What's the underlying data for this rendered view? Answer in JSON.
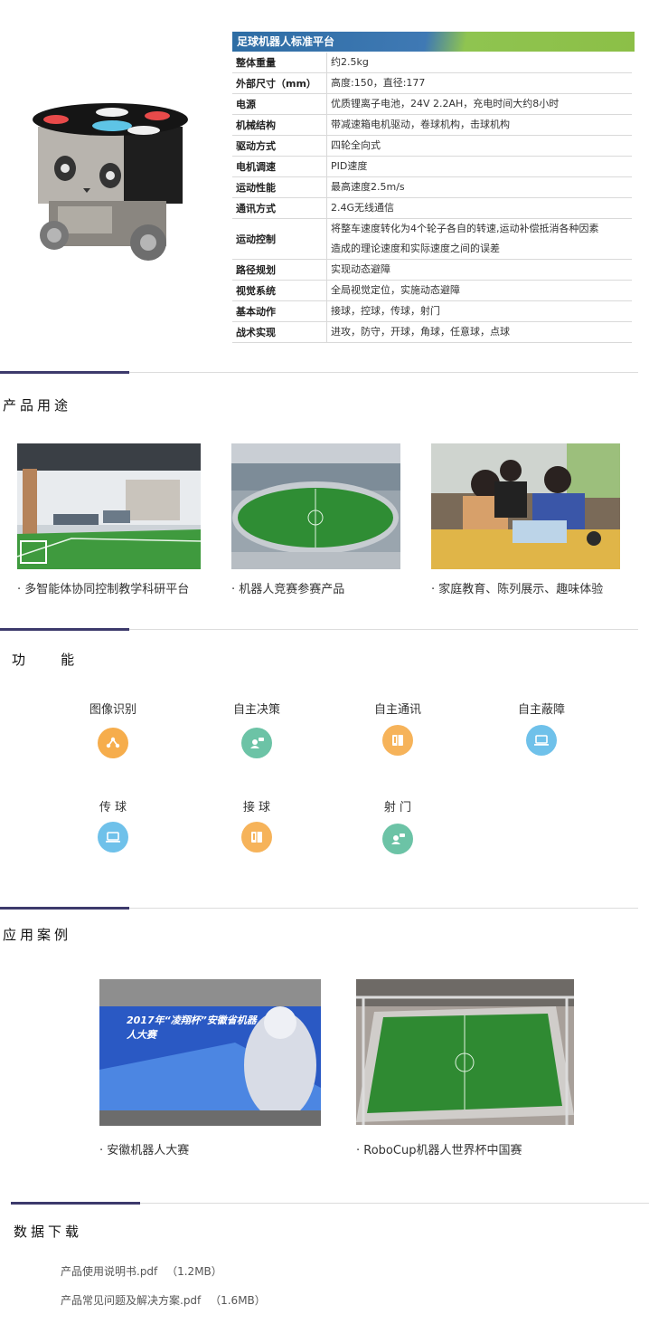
{
  "spec": {
    "title": "足球机器人标准平台",
    "rows": [
      {
        "k": "整体重量",
        "v": [
          "约2.5kg"
        ]
      },
      {
        "k": "外部尺寸（mm）",
        "v": [
          "高度:150，直径:177"
        ]
      },
      {
        "k": "电源",
        "v": [
          "优质锂离子电池，24V  2.2AH，充电时间大约8小时"
        ]
      },
      {
        "k": "机械结构",
        "v": [
          "带减速箱电机驱动，卷球机构，击球机构"
        ]
      },
      {
        "k": "驱动方式",
        "v": [
          "四轮全向式"
        ]
      },
      {
        "k": "电机调速",
        "v": [
          "PID速度"
        ]
      },
      {
        "k": "运动性能",
        "v": [
          "最高速度2.5m/s"
        ]
      },
      {
        "k": "通讯方式",
        "v": [
          "2.4G无线通信"
        ]
      },
      {
        "k": "运动控制",
        "v": [
          "将整车速度转化为4个轮子各自的转速,运动补偿抵消各种因素",
          "造成的理论速度和实际速度之间的误差"
        ]
      },
      {
        "k": "路径规划",
        "v": [
          "实现动态避障"
        ]
      },
      {
        "k": "视觉系统",
        "v": [
          "全局视觉定位，实施动态避障"
        ]
      },
      {
        "k": "基本动作",
        "v": [
          "接球，控球，传球，射门"
        ]
      },
      {
        "k": "战术实现",
        "v": [
          "进攻，防守，开球，角球，任意球，点球"
        ]
      }
    ]
  },
  "usage": {
    "title": "产品用途",
    "items": [
      {
        "caption": "· 多智能体协同控制教学科研平台"
      },
      {
        "caption": "· 机器人竞赛参赛产品"
      },
      {
        "caption": "· 家庭教育、陈列展示、趣味体验"
      }
    ]
  },
  "features": {
    "title": "功    能",
    "items": [
      {
        "label": "图像识别",
        "icon": "share-icon",
        "color": "#f6ad4c"
      },
      {
        "label": "自主决策",
        "icon": "user-chat-icon",
        "color": "#6cc3a6"
      },
      {
        "label": "自主通讯",
        "icon": "book-icon",
        "color": "#f6b35a"
      },
      {
        "label": "自主蔽障",
        "icon": "laptop-icon",
        "color": "#6fc1ea"
      },
      {
        "label": "传 球",
        "icon": "laptop-icon",
        "color": "#6fc1ea"
      },
      {
        "label": "接 球",
        "icon": "book-icon",
        "color": "#f6b35a"
      },
      {
        "label": "射 门",
        "icon": "user-chat-icon",
        "color": "#6cc3a6"
      }
    ]
  },
  "cases": {
    "title": "应用案例",
    "items": [
      {
        "caption": "· 安徽机器人大赛",
        "banner_text": "2017年“凌翔杯”安徽省机器人大赛"
      },
      {
        "caption": "· RoboCup机器人世界杯中国赛"
      }
    ]
  },
  "downloads": {
    "title": "数据下载",
    "items": [
      {
        "name": "产品使用说明书.pdf",
        "size": "（1.2MB）"
      },
      {
        "name": "产品常见问题及解决方案.pdf",
        "size": "（1.6MB）"
      }
    ]
  }
}
